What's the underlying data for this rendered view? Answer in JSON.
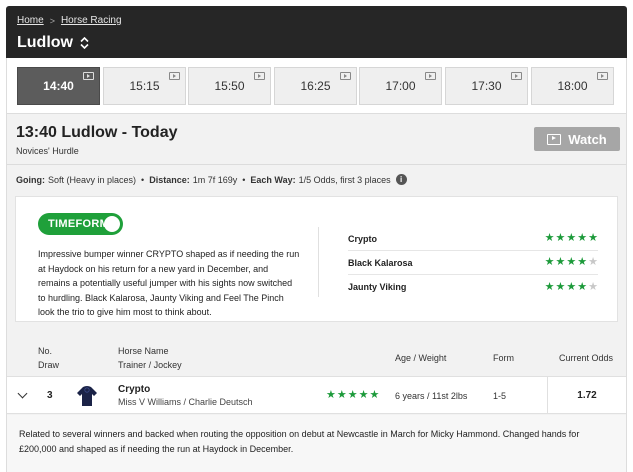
{
  "breadcrumb": {
    "home": "Home",
    "sep": ">",
    "section": "Horse Racing"
  },
  "venue": "Ludlow",
  "times": [
    {
      "label": "14:40",
      "active": true
    },
    {
      "label": "15:15",
      "active": false
    },
    {
      "label": "15:50",
      "active": false
    },
    {
      "label": "16:25",
      "active": false
    },
    {
      "label": "17:00",
      "active": false
    },
    {
      "label": "17:30",
      "active": false
    },
    {
      "label": "18:00",
      "active": false
    }
  ],
  "race": {
    "title": "13:40 Ludlow - Today",
    "subtitle": "Novices' Hurdle",
    "watch_label": "Watch",
    "going_label": "Going:",
    "going_value": "Soft (Heavy in places)",
    "distance_label": "Distance:",
    "distance_value": "1m 7f 169y",
    "eachway_label": "Each Way:",
    "eachway_value": "1/5 Odds, first 3 places",
    "info_glyph": "i",
    "bullet": "•"
  },
  "timeform": {
    "badge": "TIMEFORM",
    "verdict": "Impressive bumper winner CRYPTO shaped as if needing the run at Haydock on his return for a new yard in December, and remains a potentially useful jumper with his sights now switched to hurdling. Black Kalarosa, Jaunty Viking and Feel The Pinch look the trio to give him most to think about.",
    "selections": [
      {
        "horse": "Crypto",
        "stars": 5
      },
      {
        "horse": "Black Kalarosa",
        "stars": 4
      },
      {
        "horse": "Jaunty Viking",
        "stars": 4
      }
    ]
  },
  "table_header": {
    "no": "No.",
    "draw": "Draw",
    "horse_name": "Horse Name",
    "trainer_jockey": "Trainer / Jockey",
    "age_weight": "Age / Weight",
    "form": "Form",
    "odds": "Current Odds"
  },
  "runners": [
    {
      "draw": "3",
      "name": "Crypto",
      "connections": "Miss V Williams / Charlie Deutsch",
      "stars": 5,
      "age_weight": "6 years / 11st 2lbs",
      "form": "1-5",
      "odds": "1.72",
      "comment": "Related to several winners and backed when routing the opposition on debut at Newcastle in March for Micky Hammond. Changed hands for £200,000 and shaped as if needing the run at Haydock in December."
    }
  ],
  "colors": {
    "header": "#262626",
    "star_on": "#1c9a3a",
    "star_off": "#c8c8c8",
    "timeform_green": "#1fa03a",
    "watch_bg": "#a6a6a6"
  },
  "icons": {
    "star": "★",
    "tv": "tv-icon",
    "chevron": "chevron-down-icon"
  }
}
